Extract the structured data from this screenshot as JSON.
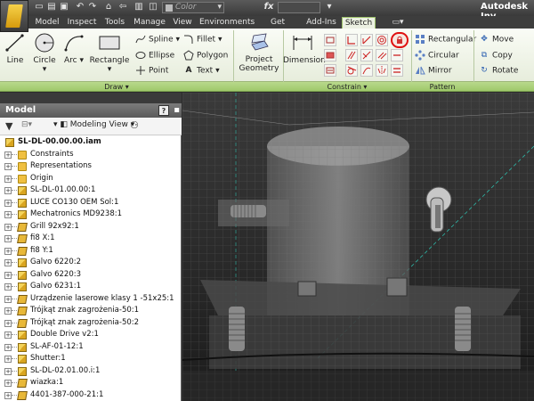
{
  "app": {
    "title": "Autodesk Inv"
  },
  "qat": {
    "color_placeholder": "Color",
    "fx": "fx"
  },
  "tabs": [
    "Model",
    "Inspect",
    "Tools",
    "Manage",
    "View",
    "Environments",
    "Get Started",
    "Add-Ins",
    "Sketch"
  ],
  "active_tab": "Sketch",
  "draw": {
    "line": "Line",
    "circle": "Circle",
    "arc": "Arc",
    "rectangle": "Rectangle",
    "spline": "Spline",
    "ellipse": "Ellipse",
    "point": "Point",
    "fillet": "Fillet",
    "polygon": "Polygon",
    "text": "Text"
  },
  "project_geometry": {
    "line1": "Project",
    "line2": "Geometry"
  },
  "dimension": "Dimension",
  "pattern": {
    "rectangular": "Rectangular",
    "circular": "Circular",
    "mirror": "Mirror"
  },
  "modify": {
    "move": "Move",
    "copy": "Copy",
    "rotate": "Rotate"
  },
  "groups": {
    "draw": "Draw",
    "constrain": "Constrain",
    "pattern": "Pattern"
  },
  "panel": {
    "title": "Model",
    "view": "Modeling View"
  },
  "tree": [
    {
      "label": "SL-DL-00.00.00.iam",
      "icon": "assembly"
    },
    {
      "label": "Constraints",
      "icon": "folder"
    },
    {
      "label": "Representations",
      "icon": "folder"
    },
    {
      "label": "Origin",
      "icon": "folder"
    },
    {
      "label": "SL-DL-01.00.00:1",
      "icon": "assembly"
    },
    {
      "label": "LUCE CO130 OEM Sol:1",
      "icon": "assembly"
    },
    {
      "label": "Mechatronics MD9238:1",
      "icon": "assembly"
    },
    {
      "label": "Grill 92x92:1",
      "icon": "part"
    },
    {
      "label": "fi8 X:1",
      "icon": "part"
    },
    {
      "label": "fi8 Y:1",
      "icon": "part"
    },
    {
      "label": "Galvo 6220:2",
      "icon": "assembly"
    },
    {
      "label": "Galvo 6220:3",
      "icon": "assembly"
    },
    {
      "label": "Galvo 6231:1",
      "icon": "assembly"
    },
    {
      "label": "Urządzenie laserowe klasy 1 -51x25:1",
      "icon": "part"
    },
    {
      "label": "Trójkąt znak zagrożenia-50:1",
      "icon": "part"
    },
    {
      "label": "Trójkąt znak zagrożenia-50:2",
      "icon": "part"
    },
    {
      "label": "Double Drive v2:1",
      "icon": "assembly"
    },
    {
      "label": "SL-AF-01-12:1",
      "icon": "assembly"
    },
    {
      "label": "Shutter:1",
      "icon": "assembly"
    },
    {
      "label": "SL-DL-02.01.00.i:1",
      "icon": "assembly"
    },
    {
      "label": "wiazka:1",
      "icon": "part"
    },
    {
      "label": "4401-387-000-21:1",
      "icon": "part"
    }
  ],
  "colors": {
    "accent": "#9ec86a",
    "highlight": "#e01010",
    "folder": "#f0c040"
  }
}
